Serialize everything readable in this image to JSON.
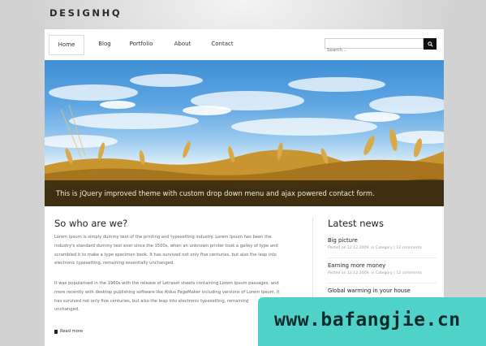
{
  "brand": {
    "logo_main": "DESIGN",
    "logo_suffix": "HQ"
  },
  "nav": {
    "items": [
      {
        "label": "Home"
      },
      {
        "label": "Blog"
      },
      {
        "label": "Portfolio"
      },
      {
        "label": "About"
      },
      {
        "label": "Contact"
      }
    ],
    "active": "Home"
  },
  "search": {
    "placeholder": "Search..."
  },
  "hero": {
    "caption": "This is jQuery improved theme with custom drop down menu and ajax powered contact form."
  },
  "about": {
    "title": "So who are we?",
    "para1": [
      "Lorem Ipsum is simply dummy text of the printing and typesetting industry. Lorem Ipsum has been the",
      "industry's standard dummy text ever since the 1500s, when an unknown printer took a galley of type and",
      "scrambled it to make a type specimen book. It has survived not only five centuries, but also the leap into",
      "electronic typesetting, remaining essentially unchanged."
    ],
    "para2": [
      "It was popularised in the 1960s with the release of Letraset sheets containing Lorem Ipsum passages, and",
      "more recently with desktop publishing software like Aldus PageMaker including versions of Lorem Ipsum. It",
      "has survived not only five centuries, but also the leap into electronic typesetting, remaining",
      "unchanged."
    ],
    "read_more": "Read more"
  },
  "news": {
    "title": "Latest news",
    "items": [
      {
        "title": "Big picture",
        "meta": "Posted on 12.12.2009. in Category | 12 comments"
      },
      {
        "title": "Earning more money",
        "meta": "Posted on 12.12.2009. in Category | 12 comments"
      },
      {
        "title": "Global warming in your house",
        "meta": ""
      }
    ]
  },
  "watermark": {
    "text": "www.bafangjie.cn"
  },
  "colors": {
    "caption_bg": "#3a2d10",
    "watermark_bg": "#4fd2c8",
    "page_bg": "#ffffff"
  }
}
